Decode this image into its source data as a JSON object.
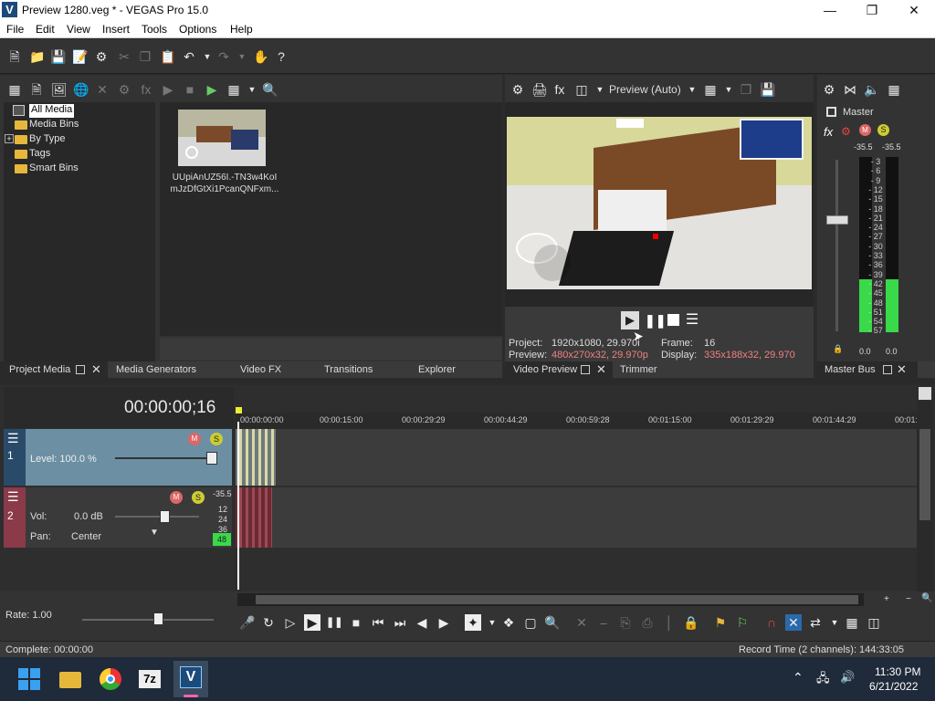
{
  "window": {
    "title": "Preview 1280.veg * - VEGAS Pro 15.0",
    "app_letter": "V"
  },
  "menu": [
    "File",
    "Edit",
    "View",
    "Insert",
    "Tools",
    "Options",
    "Help"
  ],
  "project_media": {
    "tree": [
      "All Media",
      "Media Bins",
      "By Type",
      "Tags",
      "Smart Bins"
    ],
    "expander": "+",
    "clip_name_line1": "UUpiAnUZ56I.-TN3w4KoI",
    "clip_name_line2": "mJzDfGtXi1PcanQNFxm..."
  },
  "left_tabs": [
    "Project Media",
    "Media Generators",
    "Video FX",
    "Transitions",
    "Explorer"
  ],
  "preview": {
    "quality": "Preview (Auto)",
    "project_label": "Project:",
    "project_value": "1920x1080, 29.970i",
    "preview_label": "Preview:",
    "preview_value": "480x270x32, 29.970p",
    "frame_label": "Frame:",
    "frame_value": "16",
    "display_label": "Display:",
    "display_value": "335x188x32, 29.970",
    "tabs": [
      "Video Preview",
      "Trimmer"
    ]
  },
  "master": {
    "label": "Master",
    "peak_left": "-35.5",
    "peak_right": "-35.5",
    "scale": [
      "3",
      "6",
      "9",
      "12",
      "15",
      "18",
      "21",
      "24",
      "27",
      "30",
      "33",
      "36",
      "39",
      "42",
      "45",
      "48",
      "51",
      "54",
      "57"
    ],
    "bottom_left": "0.0",
    "bottom_right": "0.0",
    "tab": "Master Bus",
    "level_fraction": 0.3
  },
  "timeline": {
    "timecode": "00:00:00;16",
    "ruler": [
      "00:00:00:00",
      "00:00:15:00",
      "00:00:29:29",
      "00:00:44:29",
      "00:00:59:28",
      "00:01:15:00",
      "00:01:29:29",
      "00:01:44:29",
      "00:01:"
    ],
    "video_track": {
      "number": "1",
      "level_label": "Level: 100.0 %"
    },
    "audio_track": {
      "number": "2",
      "vol_label": "Vol:",
      "vol_value": "0.0 dB",
      "pan_label": "Pan:",
      "pan_value": "Center",
      "meter_peak": "-35.5",
      "meter_vals": [
        "12",
        "24",
        "36",
        "48"
      ]
    },
    "rate": "Rate: 1.00"
  },
  "status": {
    "left": "Complete: 00:00:00",
    "right": "Record Time (2 channels): 144:33:05"
  },
  "taskbar": {
    "time": "11:30 PM",
    "date": "6/21/2022",
    "sevenzip": "7z",
    "vegas": "V"
  },
  "colors": {
    "accent_green": "#39d94a",
    "folder": "#e7b73c",
    "track_video": "#6c8fa3",
    "track_audio": "#8b3a4a"
  }
}
